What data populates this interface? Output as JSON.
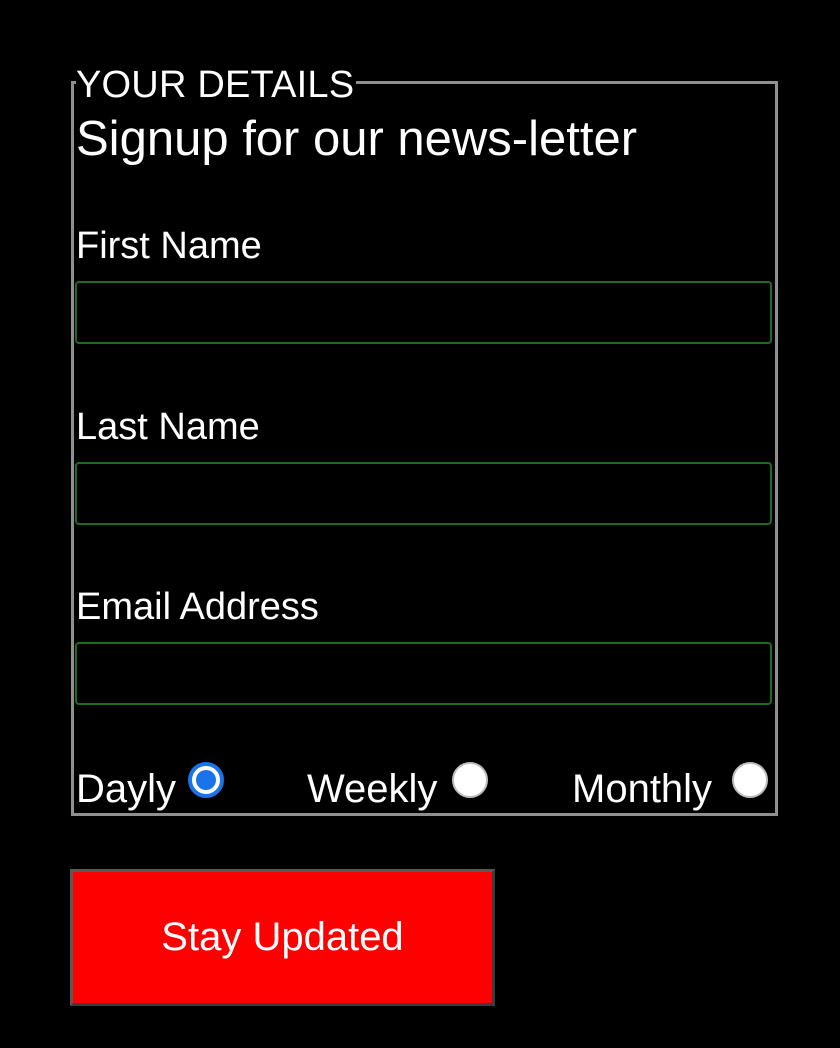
{
  "form": {
    "legend": "YOUR DETAILS",
    "title": "Signup for our news-letter",
    "fields": [
      {
        "label": "First Name",
        "value": "",
        "placeholder": ""
      },
      {
        "label": "Last Name",
        "value": "",
        "placeholder": ""
      },
      {
        "label": "Email Address",
        "value": "",
        "placeholder": ""
      }
    ],
    "frequency": {
      "options": [
        {
          "label": "Dayly",
          "checked": true
        },
        {
          "label": "Weekly",
          "checked": false
        },
        {
          "label": "Monthly",
          "checked": false
        }
      ]
    },
    "submit_label": "Stay Updated"
  },
  "colors": {
    "background": "#000000",
    "text": "#ffffff",
    "fieldset_border": "#8f8f8f",
    "input_border": "#1f6b1f",
    "radio_selected": "#1a73e8",
    "button_bg": "#ff0000"
  }
}
